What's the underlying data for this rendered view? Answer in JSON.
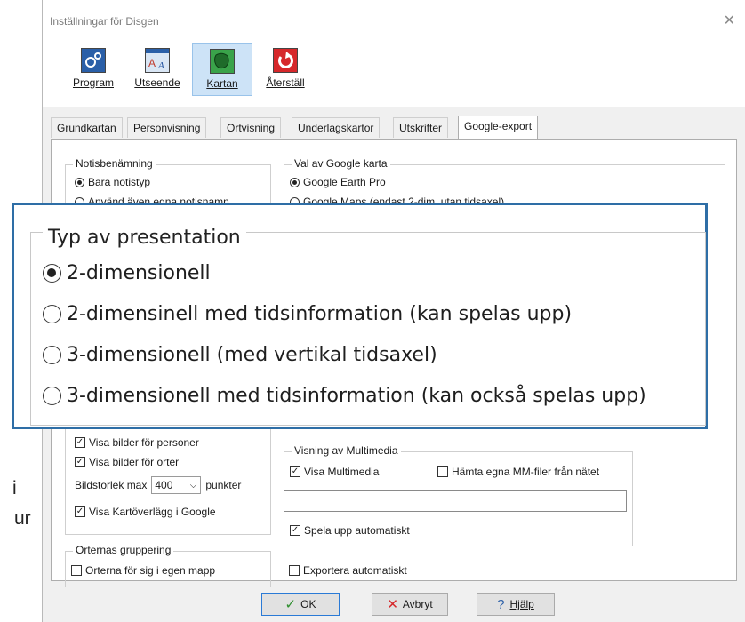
{
  "outside_text": [
    "i",
    "ur"
  ],
  "window": {
    "title": "Inställningar för Disgen",
    "close": "✕"
  },
  "toolbar": [
    {
      "label": "Program",
      "icon": "gears-icon",
      "color": "#2a5fa8"
    },
    {
      "label": "Utseende",
      "icon": "text-style-icon",
      "color": "#d9e6f5"
    },
    {
      "label": "Kartan",
      "icon": "map-icon",
      "color": "#3aa34a",
      "selected": true
    },
    {
      "label": "Återställ",
      "icon": "reset-arrow-icon",
      "color": "#d6282b"
    }
  ],
  "tabs": [
    "Grundkartan",
    "Personvisning",
    "Ortvisning",
    "Underlagskartor",
    "Utskrifter",
    "Google-export"
  ],
  "active_tab": "Google-export",
  "notis": {
    "title": "Notisbenämning",
    "options": [
      {
        "label": "Bara notistyp",
        "selected": true
      },
      {
        "label": "Använd även egna notisnamn",
        "selected": false
      }
    ]
  },
  "karta": {
    "title": "Val av Google karta",
    "options": [
      {
        "label": "Google Earth Pro",
        "selected": true
      },
      {
        "label": "Google Maps (endast 2-dim, utan tidsaxel)",
        "selected": false
      }
    ]
  },
  "bilder": {
    "visa_personer": "Visa bilder för personer",
    "visa_orter": "Visa bilder för orter",
    "storlek_label": "Bildstorlek max",
    "storlek_value": "400",
    "storlek_unit": "punkter",
    "kartoverlagg": "Visa Kartöverlägg i Google"
  },
  "gruppering": {
    "title": "Orternas gruppering",
    "option": "Orterna för sig i egen mapp"
  },
  "multimedia": {
    "title": "Visning av  Multimedia",
    "visa": "Visa Multimedia",
    "hamta": "Hämta egna MM-filer från nätet",
    "spela": "Spela upp  automatiskt",
    "input_value": ""
  },
  "exportera": "Exportera automatiskt",
  "buttons": {
    "ok": "OK",
    "avbryt": "Avbryt",
    "hjalp": "Hjälp",
    "ok_icon": "✓",
    "avbryt_icon": "✕",
    "hjalp_icon": "?"
  },
  "zoom": {
    "title": "Typ av presentation",
    "options": [
      {
        "label": "2-dimensionell",
        "selected": true
      },
      {
        "label": "2-dimensinell med tidsinformation (kan spelas upp)",
        "selected": false
      },
      {
        "label": "3-dimensionell (med vertikal tidsaxel)",
        "selected": false
      },
      {
        "label": "3-dimensionell med tidsinformation (kan också spelas upp)",
        "selected": false
      }
    ]
  },
  "colors": {
    "highlight_border": "#2e6ea6",
    "selected_tool": "#cde3f7"
  }
}
